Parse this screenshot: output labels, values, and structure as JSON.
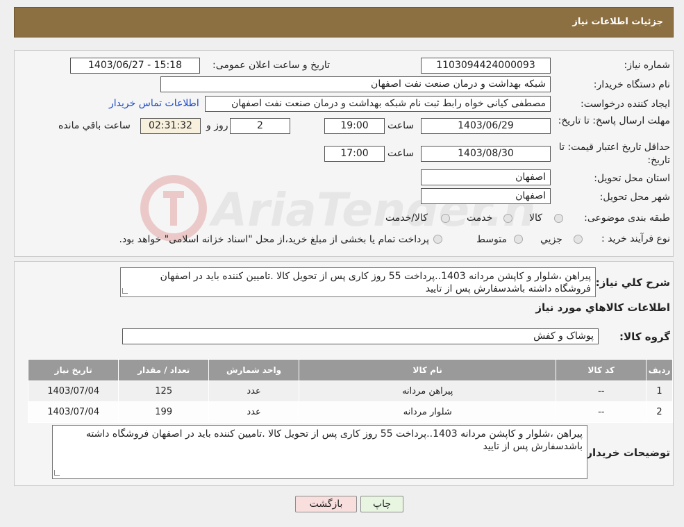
{
  "header": {
    "title": "جزئیات اطلاعات نیاز"
  },
  "form": {
    "need_number_label": "شماره نیاز:",
    "need_number": "1103094424000093",
    "announce_label": "تاریخ و ساعت اعلان عمومی:",
    "announce_value": "1403/06/27 - 15:18",
    "buyer_org_label": "نام دستگاه خریدار:",
    "buyer_org": "شبکه بهداشت و درمان صنعت نفت اصفهان",
    "creator_label": "ایجاد کننده درخواست:",
    "creator": "مصطفی کیانی خواه رابط ثبت نام شبکه بهداشت و درمان صنعت نفت اصفهان",
    "contact_link": "اطلاعات تماس خریدار",
    "deadline_label": "مهلت ارسال پاسخ: تا تاریخ:",
    "deadline_date": "1403/06/29",
    "time_label": "ساعت",
    "deadline_time": "19:00",
    "days_value": "2",
    "days_label": "روز و",
    "remaining_time": "02:31:32",
    "remaining_label": "ساعت باقي مانده",
    "min_validity_label": "حداقل تاریخ اعتبار قیمت: تا تاریخ:",
    "min_validity_date": "1403/08/30",
    "min_validity_time": "17:00",
    "province_label": "استان محل تحویل:",
    "province": "اصفهان",
    "city_label": "شهر محل تحویل:",
    "city": "اصفهان",
    "category_label": "طبقه بندی موضوعی:",
    "category_options": [
      "کالا",
      "خدمت",
      "کالا/خدمت"
    ],
    "process_label": "نوع فرآیند خرید :",
    "process_options": [
      "جزيي",
      "متوسط"
    ],
    "process_note": "پرداخت تمام یا بخشی از مبلغ خرید،از محل \"اسناد خزانه اسلامی\" خواهد بود."
  },
  "description": {
    "label": "شرح کلي نياز:",
    "text": "پیراهن ،شلوار و کاپشن مردانه 1403..پرداخت 55 روز کاری  پس از تحویل کالا .تامیین کننده باید در اصفهان فروشگاه داشته باشدسفارش پس از تایید"
  },
  "goods": {
    "section_title": "اطلاعات کالاهاي مورد نياز",
    "group_label": "گروه کالا:",
    "group_value": "پوشاک و کفش",
    "columns": [
      "رديف",
      "کد کالا",
      "نام کالا",
      "واحد شمارش",
      "تعداد / مقدار",
      "تاریخ نیاز"
    ],
    "rows": [
      [
        "1",
        "--",
        "پیراهن مردانه",
        "عدد",
        "125",
        "1403/07/04"
      ],
      [
        "2",
        "--",
        "شلوار مردانه",
        "عدد",
        "199",
        "1403/07/04"
      ]
    ]
  },
  "buyer_notes": {
    "label": "توضیحات خریدار:",
    "text": "پیراهن ،شلوار و کاپشن مردانه 1403..پرداخت 55 روز کاری  پس از تحویل کالا .تامیین کننده باید در اصفهان فروشگاه داشته باشدسفارش پس از تایید"
  },
  "buttons": {
    "print": "چاپ",
    "back": "بازگشت"
  },
  "watermark": {
    "text": "AriaTender.neT"
  },
  "colors": {
    "header_bg": "#8c7042",
    "link": "#1a49c9",
    "back_button_bg": "#f9dede",
    "print_button_bg": "#e8f6e1"
  }
}
